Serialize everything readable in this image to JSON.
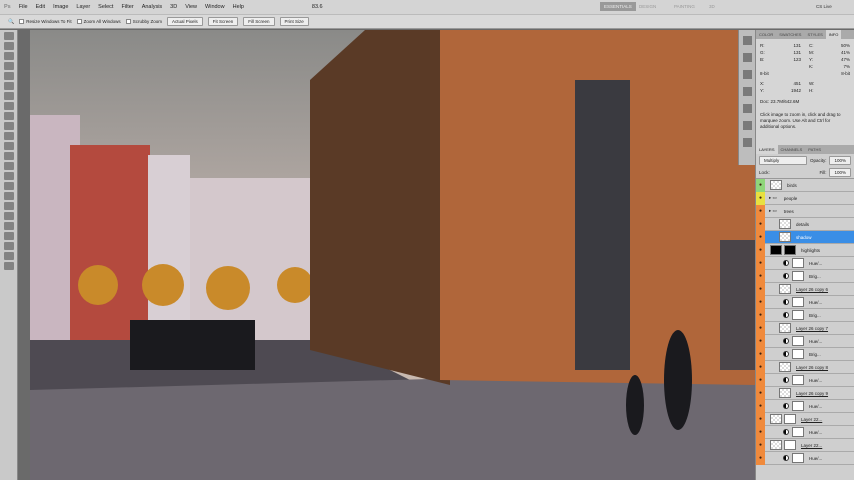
{
  "menu": {
    "logo": "Ps",
    "items": [
      "File",
      "Edit",
      "Image",
      "Layer",
      "Select",
      "Filter",
      "Analysis",
      "3D",
      "View",
      "Window",
      "Help"
    ],
    "zoom": "83.6",
    "workspaces": [
      "ESSENTIALS",
      "DESIGN",
      "PAINTING",
      "3D"
    ],
    "cslive": "CS Live"
  },
  "options": {
    "resize": "Resize Windows To Fit",
    "zoom_all": "Zoom All Windows",
    "scrubby": "Scrubby Zoom",
    "actual": "Actual Pixels",
    "fit": "Fit Screen",
    "fill": "Fill Screen",
    "print": "Print Size"
  },
  "info": {
    "tabs": [
      "COLOR",
      "SWATCHES",
      "STYLES",
      "INFO"
    ],
    "rgb": [
      [
        "R:",
        "131"
      ],
      [
        "G:",
        "131"
      ],
      [
        "B:",
        "123"
      ]
    ],
    "cmyk": [
      [
        "C:",
        "50%"
      ],
      [
        "M:",
        "41%"
      ],
      [
        "Y:",
        "47%"
      ],
      [
        "K:",
        "7%"
      ]
    ],
    "bit": "8-bit",
    "xy": [
      [
        "X:",
        "451"
      ],
      [
        "Y:",
        "1942"
      ]
    ],
    "wh": [
      [
        "W:",
        ""
      ],
      [
        "H:",
        ""
      ]
    ],
    "doc": "Doc: 23.7M/642.6M",
    "hint": "Click image to zoom in, click and drag to marquee zoom.  Use Alt and Ctrl for additional options."
  },
  "layers": {
    "tabs": [
      "LAYERS",
      "CHANNELS",
      "PATHS"
    ],
    "blend": "Multiply",
    "opacity_label": "Opacity:",
    "opacity": "100%",
    "lock": "Lock:",
    "fill_label": "Fill:",
    "fill": "100%",
    "rows": [
      {
        "name": "birds",
        "type": "layer",
        "eye": "green"
      },
      {
        "name": "people",
        "type": "group",
        "eye": "yellow"
      },
      {
        "name": "trees",
        "type": "group"
      },
      {
        "name": "details",
        "type": "layer"
      },
      {
        "name": "shadow",
        "type": "layer",
        "selected": true
      },
      {
        "name": "highlights",
        "type": "black"
      },
      {
        "name": "Hue/...",
        "type": "adj"
      },
      {
        "name": "Brig...",
        "type": "adj"
      },
      {
        "name": "Layer 26 copy 6",
        "type": "layer"
      },
      {
        "name": "Hue/...",
        "type": "adj"
      },
      {
        "name": "Brig...",
        "type": "adj"
      },
      {
        "name": "Layer 26 copy 7",
        "type": "layer"
      },
      {
        "name": "Hue/...",
        "type": "adj"
      },
      {
        "name": "Brig...",
        "type": "adj"
      },
      {
        "name": "Layer 26 copy 8",
        "type": "layer"
      },
      {
        "name": "Hue/...",
        "type": "adj"
      },
      {
        "name": "Layer 26 copy 9",
        "type": "layer"
      },
      {
        "name": "Hue/...",
        "type": "adj"
      },
      {
        "name": "Layer 22...",
        "type": "masked"
      },
      {
        "name": "Hue/...",
        "type": "adj"
      },
      {
        "name": "Layer 22...",
        "type": "masked"
      },
      {
        "name": "Hue/...",
        "type": "adj"
      }
    ]
  },
  "colors": {
    "selected": "#3a8ee6",
    "eye_orange": "#f08a3c",
    "eye_green": "#8fd67a",
    "eye_yellow": "#e8e040"
  }
}
